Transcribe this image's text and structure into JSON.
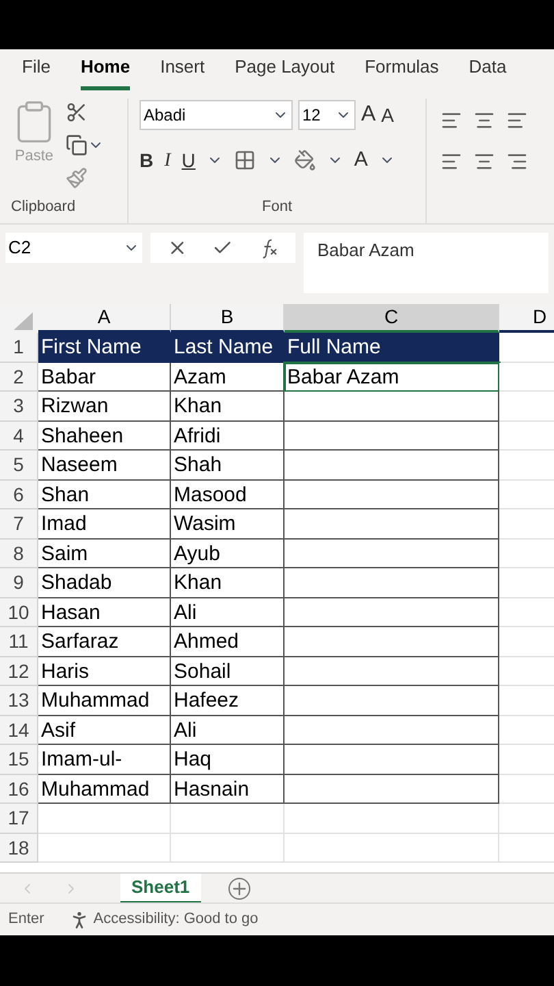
{
  "ribbon_tabs": [
    {
      "label": "File",
      "selected": false
    },
    {
      "label": "Home",
      "selected": true
    },
    {
      "label": "Insert",
      "selected": false
    },
    {
      "label": "Page Layout",
      "selected": false
    },
    {
      "label": "Formulas",
      "selected": false
    },
    {
      "label": "Data",
      "selected": false
    }
  ],
  "clipboard": {
    "paste_label": "Paste",
    "group_label": "Clipboard"
  },
  "font": {
    "name": "Abadi",
    "size": "12",
    "grow": "A",
    "shrink": "A",
    "bold": "B",
    "italic": "I",
    "underline": "U",
    "font_color": "A",
    "group_label": "Font"
  },
  "formula_bar": {
    "name_box": "C2",
    "value": "Babar Azam"
  },
  "columns": [
    {
      "label": "A",
      "selected": false
    },
    {
      "label": "B",
      "selected": false
    },
    {
      "label": "C",
      "selected": true
    },
    {
      "label": "D",
      "selected": false
    }
  ],
  "rows": [
    {
      "number": "1",
      "kind": "header",
      "cells": [
        {
          "text": "First Name",
          "selected": false
        },
        {
          "text": "Last Name",
          "selected": false
        },
        {
          "text": "Full Name",
          "selected": false
        }
      ]
    },
    {
      "number": "2",
      "kind": "data",
      "cells": [
        {
          "text": "Babar",
          "selected": false
        },
        {
          "text": "Azam",
          "selected": false
        },
        {
          "text": "Babar Azam",
          "selected": true
        }
      ]
    },
    {
      "number": "3",
      "kind": "data",
      "cells": [
        {
          "text": "Rizwan",
          "selected": false
        },
        {
          "text": "Khan",
          "selected": false
        }
      ]
    },
    {
      "number": "4",
      "kind": "data",
      "cells": [
        {
          "text": "Shaheen",
          "selected": false
        },
        {
          "text": "Afridi",
          "selected": false
        }
      ]
    },
    {
      "number": "5",
      "kind": "data",
      "cells": [
        {
          "text": "Naseem",
          "selected": false
        },
        {
          "text": "Shah",
          "selected": false
        }
      ]
    },
    {
      "number": "6",
      "kind": "data",
      "cells": [
        {
          "text": "Shan",
          "selected": false
        },
        {
          "text": "Masood",
          "selected": false
        }
      ]
    },
    {
      "number": "7",
      "kind": "data",
      "cells": [
        {
          "text": "Imad",
          "selected": false
        },
        {
          "text": "Wasim",
          "selected": false
        }
      ]
    },
    {
      "number": "8",
      "kind": "data",
      "cells": [
        {
          "text": "Saim",
          "selected": false
        },
        {
          "text": "Ayub",
          "selected": false
        }
      ]
    },
    {
      "number": "9",
      "kind": "data",
      "cells": [
        {
          "text": "Shadab",
          "selected": false
        },
        {
          "text": "Khan",
          "selected": false
        }
      ]
    },
    {
      "number": "10",
      "kind": "data",
      "cells": [
        {
          "text": "Hasan",
          "selected": false
        },
        {
          "text": "Ali",
          "selected": false
        }
      ]
    },
    {
      "number": "11",
      "kind": "data",
      "cells": [
        {
          "text": "Sarfaraz",
          "selected": false
        },
        {
          "text": "Ahmed",
          "selected": false
        }
      ]
    },
    {
      "number": "12",
      "kind": "data",
      "cells": [
        {
          "text": "Haris",
          "selected": false
        },
        {
          "text": "Sohail",
          "selected": false
        }
      ]
    },
    {
      "number": "13",
      "kind": "data",
      "cells": [
        {
          "text": "Muhammad",
          "selected": false
        },
        {
          "text": "Hafeez",
          "selected": false
        }
      ]
    },
    {
      "number": "14",
      "kind": "data",
      "cells": [
        {
          "text": "Asif",
          "selected": false
        },
        {
          "text": "Ali",
          "selected": false
        }
      ]
    },
    {
      "number": "15",
      "kind": "data",
      "cells": [
        {
          "text": "Imam-ul-",
          "selected": false
        },
        {
          "text": "Haq",
          "selected": false
        }
      ]
    },
    {
      "number": "16",
      "kind": "data",
      "cells": [
        {
          "text": "Muhammad",
          "selected": false
        },
        {
          "text": "Hasnain",
          "selected": false
        }
      ]
    },
    {
      "number": "17",
      "kind": "empty",
      "cells": []
    },
    {
      "number": "18",
      "kind": "empty",
      "cells": []
    }
  ],
  "sheet_tabs": [
    {
      "label": "Sheet1",
      "selected": true
    }
  ],
  "status_bar": {
    "mode": "Enter",
    "accessibility": "Accessibility: Good to go"
  }
}
